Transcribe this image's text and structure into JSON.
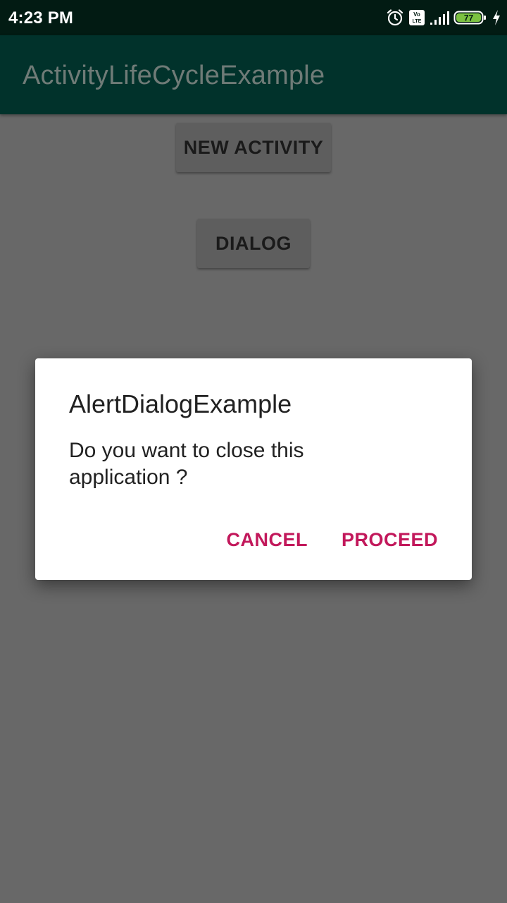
{
  "status_bar": {
    "time": "4:23 PM",
    "battery_level": "77",
    "icons": [
      "alarm-icon",
      "volte-icon",
      "signal-icon",
      "battery-icon",
      "charging-icon"
    ]
  },
  "app_bar": {
    "title": "ActivityLifeCycleExample"
  },
  "main": {
    "new_activity_label": "NEW ACTIVITY",
    "dialog_label": "DIALOG"
  },
  "dialog": {
    "title": "AlertDialogExample",
    "message": "Do you want to close this application ?",
    "cancel_label": "CANCEL",
    "proceed_label": "PROCEED"
  },
  "colors": {
    "status_bar": "#021b13",
    "app_bar": "#01322b",
    "scrim_background": "#686868",
    "accent": "#c2185b",
    "battery": "#7cc242"
  }
}
